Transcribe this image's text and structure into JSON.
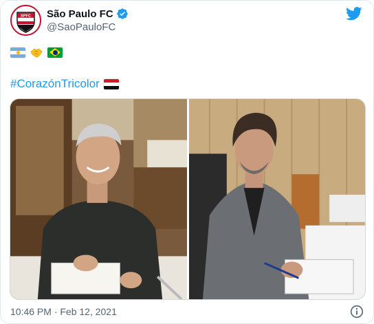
{
  "account": {
    "display_name": "São Paulo FC",
    "handle": "@SaoPauloFC",
    "avatar_text": "SPFC",
    "verified": true
  },
  "tweet": {
    "hashtag": "#CorazónTricolor",
    "emoji_line": [
      "argentina-flag",
      "handshake-emoji",
      "brazil-flag"
    ],
    "hashtag_emoji": "tricolor-flag",
    "timestamp": "10:46 PM · Feb 12, 2021"
  },
  "media": {
    "photos": [
      "man-signing-contract-restaurant",
      "man-signing-contract-office"
    ]
  },
  "icons": {
    "brand": "twitter-bird-icon",
    "verified": "verified-badge-icon",
    "info": "info-icon"
  },
  "colors": {
    "twitter_blue": "#1d9bf0",
    "club_red": "#c8102e",
    "secondary_text": "#536471"
  }
}
